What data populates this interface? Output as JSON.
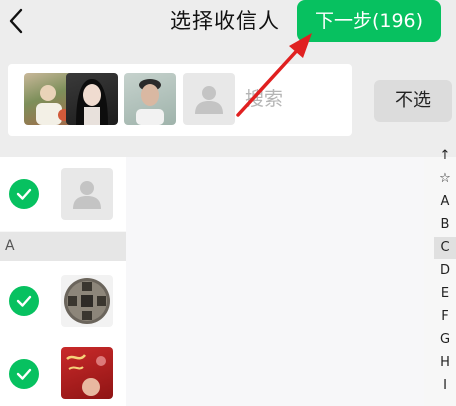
{
  "header": {
    "title": "选择收信人",
    "next_label": "下一步(196)",
    "back_icon": "chevron-left-icon"
  },
  "search": {
    "placeholder": "搜索",
    "value": ""
  },
  "deselect_label": "不选",
  "selected_avatars": [
    {
      "name": "avatar-1"
    },
    {
      "name": "avatar-2"
    },
    {
      "name": "avatar-3"
    }
  ],
  "list": {
    "section_letter": "A",
    "rows": [
      {
        "checked": true,
        "avatar": "default-person-icon"
      },
      {
        "checked": true,
        "avatar": "coin-avatar"
      },
      {
        "checked": true,
        "avatar": "red-avatar"
      }
    ]
  },
  "index_bar": [
    "↑",
    "☆",
    "A",
    "B",
    "C",
    "D",
    "E",
    "F",
    "G",
    "H",
    "I"
  ],
  "index_highlight": "C",
  "colors": {
    "accent": "#07c160",
    "annotation_arrow": "#e02020"
  }
}
